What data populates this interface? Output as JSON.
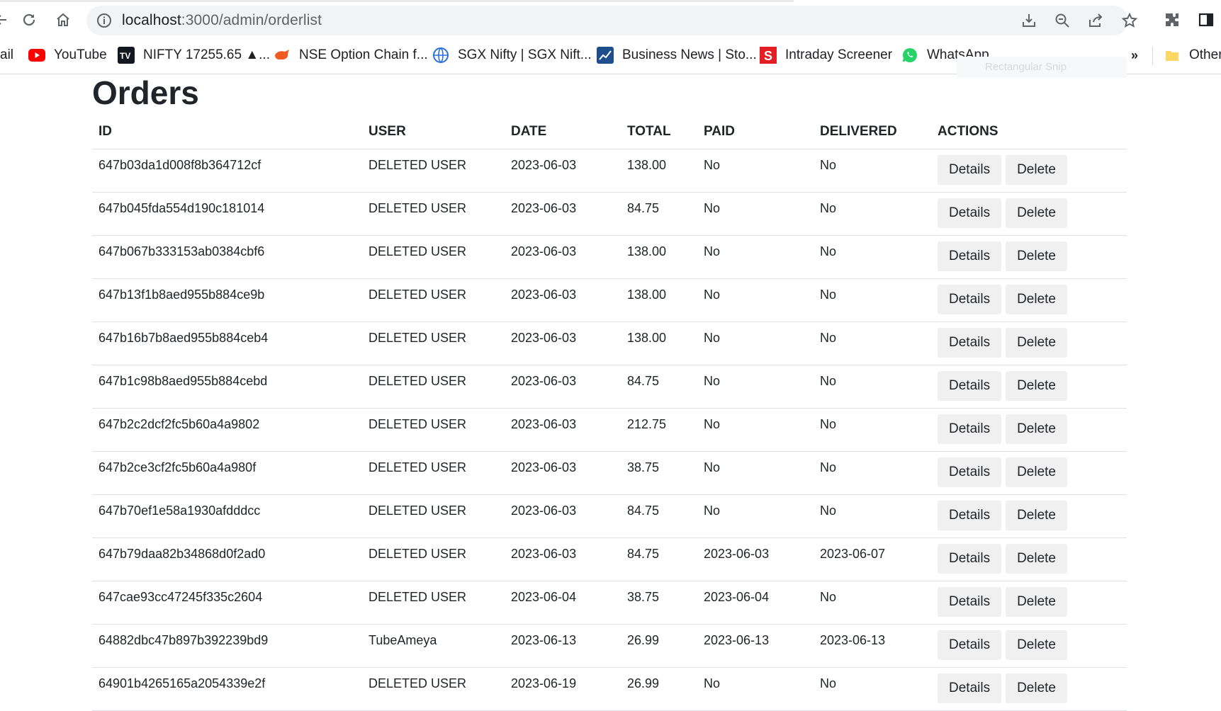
{
  "browser": {
    "url_host": "localhost",
    "url_path": ":3000/admin/orderlist",
    "bookmarks": [
      {
        "label": "ail",
        "icon": "partial-bookmark"
      },
      {
        "label": "YouTube",
        "icon": "youtube-icon"
      },
      {
        "label": "NIFTY 17255.65 ▲...",
        "icon": "tradingview-icon"
      },
      {
        "label": "NSE Option Chain f...",
        "icon": "bull-icon"
      },
      {
        "label": "SGX Nifty | SGX Nift...",
        "icon": "globe-icon"
      },
      {
        "label": "Business News | Sto...",
        "icon": "chart-icon"
      },
      {
        "label": "Intraday Screener",
        "icon": "screener-icon"
      },
      {
        "label": "WhatsApp",
        "icon": "whatsapp-icon"
      },
      {
        "label": "Other",
        "icon": "folder-icon"
      }
    ],
    "more_label": "»",
    "ghost_label": "Rectangular Snip"
  },
  "page": {
    "title": "Orders",
    "columns": [
      "ID",
      "USER",
      "DATE",
      "TOTAL",
      "PAID",
      "DELIVERED",
      "ACTIONS"
    ],
    "details_label": "Details",
    "delete_label": "Delete",
    "rows": [
      {
        "id": "647b03da1d008f8b364712cf",
        "user": "DELETED USER",
        "date": "2023-06-03",
        "total": "138.00",
        "paid": "No",
        "delivered": "No"
      },
      {
        "id": "647b045fda554d190c181014",
        "user": "DELETED USER",
        "date": "2023-06-03",
        "total": "84.75",
        "paid": "No",
        "delivered": "No"
      },
      {
        "id": "647b067b333153ab0384cbf6",
        "user": "DELETED USER",
        "date": "2023-06-03",
        "total": "138.00",
        "paid": "No",
        "delivered": "No"
      },
      {
        "id": "647b13f1b8aed955b884ce9b",
        "user": "DELETED USER",
        "date": "2023-06-03",
        "total": "138.00",
        "paid": "No",
        "delivered": "No"
      },
      {
        "id": "647b16b7b8aed955b884ceb4",
        "user": "DELETED USER",
        "date": "2023-06-03",
        "total": "138.00",
        "paid": "No",
        "delivered": "No"
      },
      {
        "id": "647b1c98b8aed955b884cebd",
        "user": "DELETED USER",
        "date": "2023-06-03",
        "total": "84.75",
        "paid": "No",
        "delivered": "No"
      },
      {
        "id": "647b2c2dcf2fc5b60a4a9802",
        "user": "DELETED USER",
        "date": "2023-06-03",
        "total": "212.75",
        "paid": "No",
        "delivered": "No"
      },
      {
        "id": "647b2ce3cf2fc5b60a4a980f",
        "user": "DELETED USER",
        "date": "2023-06-03",
        "total": "38.75",
        "paid": "No",
        "delivered": "No"
      },
      {
        "id": "647b70ef1e58a1930afdddcc",
        "user": "DELETED USER",
        "date": "2023-06-03",
        "total": "84.75",
        "paid": "No",
        "delivered": "No"
      },
      {
        "id": "647b79daa82b34868d0f2ad0",
        "user": "DELETED USER",
        "date": "2023-06-03",
        "total": "84.75",
        "paid": "2023-06-03",
        "delivered": "2023-06-07"
      },
      {
        "id": "647cae93cc47245f335c2604",
        "user": "DELETED USER",
        "date": "2023-06-04",
        "total": "38.75",
        "paid": "2023-06-04",
        "delivered": "No"
      },
      {
        "id": "64882dbc47b897b392239bd9",
        "user": "TubeAmeya",
        "date": "2023-06-13",
        "total": "26.99",
        "paid": "2023-06-13",
        "delivered": "2023-06-13"
      },
      {
        "id": "64901b4265165a2054339e2f",
        "user": "DELETED USER",
        "date": "2023-06-19",
        "total": "26.99",
        "paid": "No",
        "delivered": "No"
      }
    ]
  }
}
